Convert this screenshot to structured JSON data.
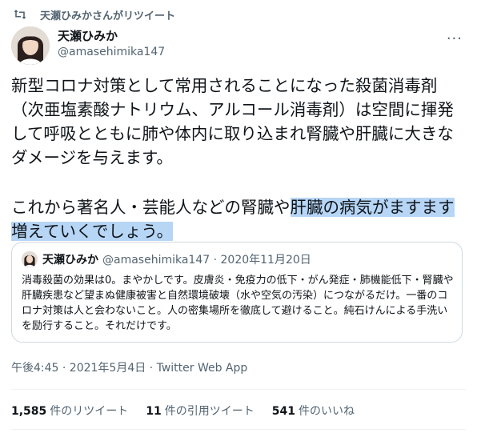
{
  "retweet_context": {
    "label": "天瀬ひみかさんがリツイート",
    "icon": "retweet-icon"
  },
  "author": {
    "name": "天瀬ひみか",
    "handle": "@amasehimika147"
  },
  "more_menu": {
    "label": "···"
  },
  "tweet": {
    "para1": "新型コロナ対策として常用されることになった殺菌消毒剤（次亜塩素酸ナトリウム、アルコール消毒剤）は空間に揮発して呼吸とともに肺や体内に取り込まれ腎臓や肝臓に大きなダメージを与えます。",
    "para2_plain": "これから著名人・芸能人などの腎臓や",
    "para2_highlight": "肝臓の病気がますます増えていくでしょう。"
  },
  "quote": {
    "name": "天瀬ひみか",
    "meta": "@amasehimika147 · 2020年11月20日",
    "text": "消毒殺菌の効果は0。まやかしです。皮膚炎・免疫力の低下・がん発症・肺機能低下・腎臓や肝臓疾患など望まぬ健康被害と自然環境破壊（水や空気の汚染）につながるだけ。一番のコロナ対策は人と会わないこと。人の密集場所を徹底して避けること。純石けんによる手洗いを励行すること。それだけです。"
  },
  "timestamp": "午後4:45 · 2021年5月4日 · Twitter Web App",
  "stats": {
    "retweets": {
      "count": "1,585",
      "label": "件のリツイート"
    },
    "quotes": {
      "count": "11",
      "label": "件の引用ツイート"
    },
    "likes": {
      "count": "541",
      "label": "件のいいね"
    }
  },
  "colors": {
    "text": "#0f1419",
    "secondary": "#536471",
    "highlight": "#b7d6f6",
    "border": "#cfd9de"
  }
}
